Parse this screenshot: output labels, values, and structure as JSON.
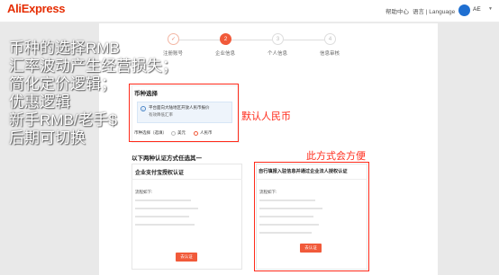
{
  "header": {
    "logo": "AliExpress",
    "logo_sub": "",
    "help_center": "帮助中心",
    "language": "语言 | Language",
    "user_name": "AE"
  },
  "steps": [
    {
      "number": "",
      "label": "注册账号",
      "state": "done"
    },
    {
      "number": "2",
      "label": "企业信息",
      "state": "active"
    },
    {
      "number": "3",
      "label": "个人信息",
      "state": "pending"
    },
    {
      "number": "4",
      "label": "信息审核",
      "state": "pending"
    }
  ],
  "currency": {
    "title": "币种选择",
    "info_text": "平台面向大陆地区开放人民币报价",
    "info_subtext": "有效降低汇率",
    "select_label": "币种选择（选填）",
    "option_usd": "美元",
    "option_cny": "人民币",
    "selected": "人民币"
  },
  "auth": {
    "section_title": "以下两种认证方式任选其一",
    "left": {
      "title": "企业支付宝授权认证",
      "flow_label": "流程如下:",
      "steps": [
        "",
        "",
        "",
        ""
      ],
      "button": "去认证"
    },
    "right": {
      "title": "自行填报入驻信息并通过企业法人授权认证",
      "flow_label": "流程如下:",
      "steps": [
        "",
        "",
        "",
        "",
        ""
      ],
      "button": "去认证"
    }
  },
  "annotations": {
    "left_lines": [
      "币种的选择RMB",
      "汇率波动产生经营损失；",
      "简化定价逻辑；",
      "优惠逻辑",
      "新手RMB/老手$",
      "后期可切换"
    ],
    "default_rmb": "默认人民币",
    "convenient": "此方式会方便"
  }
}
